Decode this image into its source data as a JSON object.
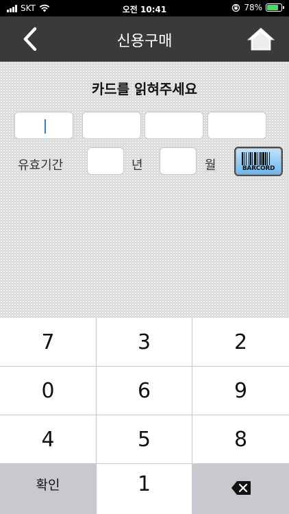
{
  "status_bar": {
    "carrier": "SKT",
    "time": "오전 10:41",
    "battery": "78%",
    "battery_level": 0.78
  },
  "header": {
    "title": "신용구매",
    "back_icon": "chevron-left-icon",
    "home_icon": "home-icon"
  },
  "form": {
    "instruction": "카드를 읽혀주세요",
    "card_fields": [
      "",
      "",
      "",
      ""
    ],
    "expiry_label": "유효기간",
    "year_unit": "년",
    "month_unit": "월",
    "barcode_label": "BARCORD"
  },
  "keypad": {
    "rows": [
      [
        "7",
        "3",
        "2"
      ],
      [
        "0",
        "6",
        "9"
      ],
      [
        "4",
        "5",
        "8"
      ]
    ],
    "confirm": "확인",
    "last_digit": "1",
    "delete_icon": "backspace-icon"
  },
  "colors": {
    "header": "#3a3a3a",
    "cursor": "#2a7bf2",
    "battery": "#4cd964",
    "barcode_top": "#bfe4ff",
    "barcode_bottom": "#6ab7ec"
  }
}
